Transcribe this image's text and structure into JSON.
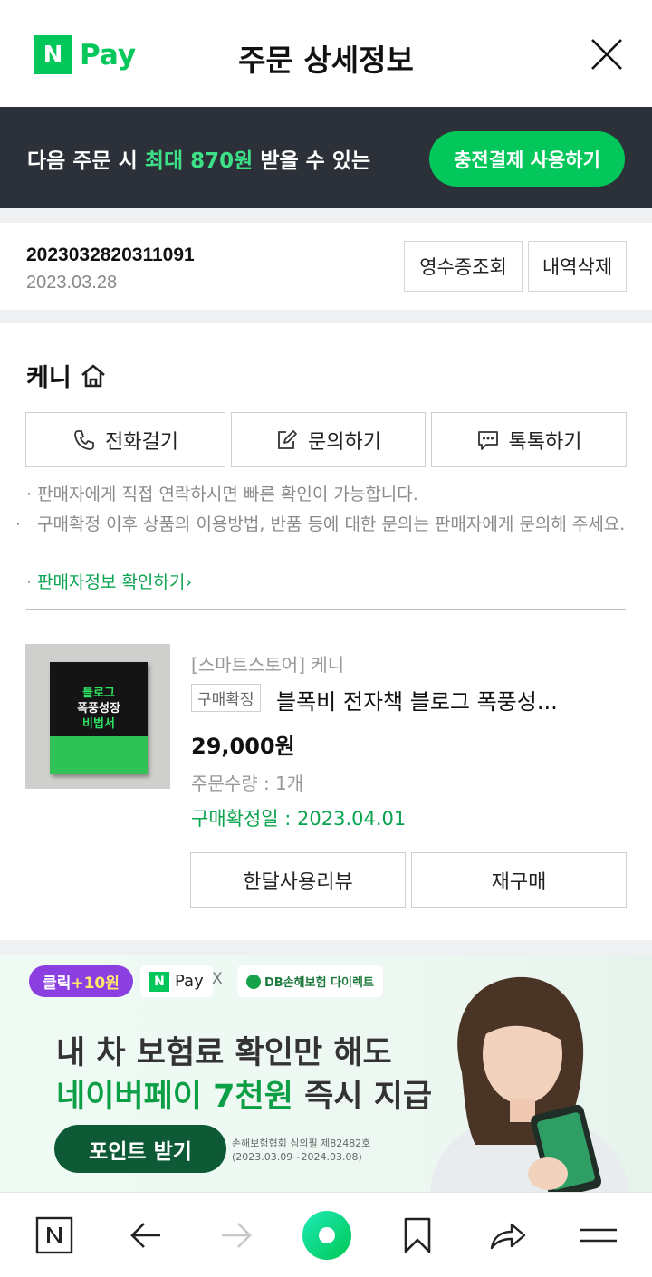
{
  "header": {
    "logo_n": "N",
    "logo_pay": "Pay",
    "title": "주문 상세정보"
  },
  "promo": {
    "text_before": "다음 주문 시 ",
    "text_highlight": "최대 870원",
    "text_after": " 받을 수 있는",
    "button": "충전결제 사용하기"
  },
  "order": {
    "number": "2023032820311091",
    "date": "2023.03.28",
    "receipt_button": "영수증조회",
    "delete_button": "내역삭제"
  },
  "seller": {
    "name": "케니",
    "buttons": {
      "call": "전화걸기",
      "inquiry": "문의하기",
      "talk": "톡톡하기"
    },
    "notes": [
      "판매자에게 직접 연락하시면 빠른 확인이 가능합니다.",
      "구매확정 이후 상품의 이용방법, 반품 등에 대한 문의는 판매자에게 문의해 주세요."
    ],
    "info_link": "판매자정보 확인하기",
    "info_link_arrow": "›"
  },
  "product": {
    "store": "[스마트스토어] 케니",
    "badge": "구매확정",
    "name": "블폭비 전자책 블로그 폭풍성...",
    "price": "29,000원",
    "quantity": "주문수량 : 1개",
    "confirm_date": "구매확정일 : 2023.04.01",
    "review_button": "한달사용리뷰",
    "rebuy_button": "재구매",
    "cover": {
      "line1": "블로그",
      "line2": "폭풍성장",
      "line3": "비법서"
    }
  },
  "ad": {
    "click_label": "클릭",
    "click_reward": "+10원",
    "npay_n": "N",
    "npay_label": "Pay",
    "times": "X",
    "db_label": "DB손해보험 다이렉트",
    "headline1": "내 차 보험료 확인만 해도",
    "headline2_green": "네이버페이 7천원",
    "headline2_rest": " 즉시 지급",
    "button": "포인트 받기",
    "fine_print1": "손해보험협회 심의필 제82482호",
    "fine_print2": "(2023.03.09~2024.03.08)"
  },
  "bottom_nav": {
    "home_n": "N"
  },
  "colors": {
    "brand_green": "#03c75a",
    "promo_bg": "#2c3038",
    "link_green": "#0aa34f"
  }
}
